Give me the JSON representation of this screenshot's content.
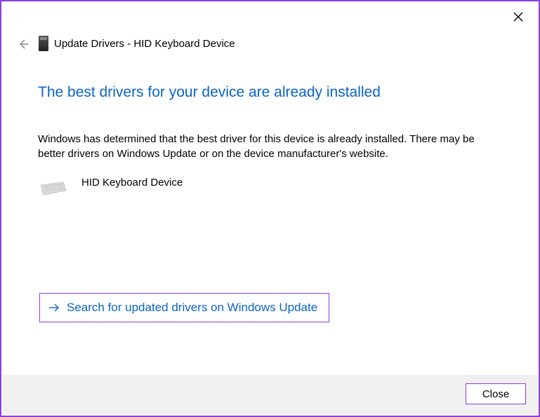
{
  "window": {
    "title_prefix": "Update Drivers",
    "title_sep": " - ",
    "title_device": "HID Keyboard Device"
  },
  "heading": "The best drivers for your device are already installed",
  "body": "Windows has determined that the best driver for this device is already installed. There may be better drivers on Windows Update or on the device manufacturer's website.",
  "device": {
    "name": "HID Keyboard Device"
  },
  "link": {
    "label": "Search for updated drivers on Windows Update"
  },
  "buttons": {
    "close": "Close"
  }
}
